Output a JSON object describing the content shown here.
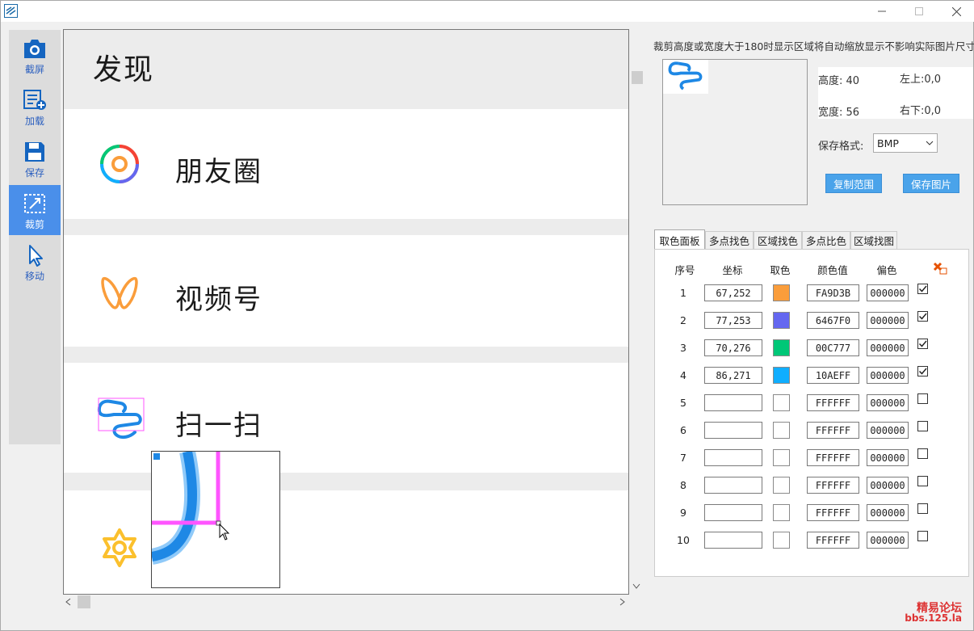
{
  "window": {
    "minimize_icon": "minimize-icon",
    "maximize_icon": "maximize-icon",
    "close_icon": "close-icon"
  },
  "sidebar": {
    "items": [
      {
        "label": "截屏",
        "icon": "camera-icon"
      },
      {
        "label": "加载",
        "icon": "load-list-icon"
      },
      {
        "label": "保存",
        "icon": "floppy-icon"
      },
      {
        "label": "裁剪",
        "icon": "crop-icon",
        "active": true
      },
      {
        "label": "移动",
        "icon": "cursor-icon"
      }
    ]
  },
  "canvas": {
    "header": "发现",
    "rows": [
      {
        "label": "朋友圈",
        "icon": "aperture-icon"
      },
      {
        "label": "视频号",
        "icon": "butterfly-icon"
      },
      {
        "label": "扫一扫",
        "icon": "scan-icon"
      },
      {
        "label": "",
        "icon": "star-icon"
      }
    ]
  },
  "right": {
    "tip": "裁剪高度或宽度大于180时显示区域将自动缩放显示不影响实际图片尺寸!",
    "height_label": "高度:",
    "height_value": "40",
    "width_label": "宽度:",
    "width_value": "56",
    "topleft_label": "左上:",
    "topleft_value": "0,0",
    "bottomright_label": "右下:",
    "bottomright_value": "0,0",
    "format_label": "保存格式:",
    "format_value": "BMP",
    "copy_button": "复制范围",
    "save_button": "保存图片"
  },
  "tabs": [
    "取色面板",
    "多点找色",
    "区域找色",
    "多点比色",
    "区域找图"
  ],
  "table": {
    "headers": [
      "序号",
      "坐标",
      "取色",
      "颜色值",
      "偏色"
    ],
    "rows": [
      {
        "no": "1",
        "coord": "67,252",
        "color": "#FA9D3B",
        "hex": "FA9D3B",
        "tol": "000000",
        "checked": true
      },
      {
        "no": "2",
        "coord": "77,253",
        "color": "#6467F0",
        "hex": "6467F0",
        "tol": "000000",
        "checked": true
      },
      {
        "no": "3",
        "coord": "70,276",
        "color": "#00C777",
        "hex": "00C777",
        "tol": "000000",
        "checked": true
      },
      {
        "no": "4",
        "coord": "86,271",
        "color": "#10AEFF",
        "hex": "10AEFF",
        "tol": "000000",
        "checked": true
      },
      {
        "no": "5",
        "coord": "",
        "color": "#FFFFFF",
        "hex": "FFFFFF",
        "tol": "000000",
        "checked": false
      },
      {
        "no": "6",
        "coord": "",
        "color": "#FFFFFF",
        "hex": "FFFFFF",
        "tol": "000000",
        "checked": false
      },
      {
        "no": "7",
        "coord": "",
        "color": "#FFFFFF",
        "hex": "FFFFFF",
        "tol": "000000",
        "checked": false
      },
      {
        "no": "8",
        "coord": "",
        "color": "#FFFFFF",
        "hex": "FFFFFF",
        "tol": "000000",
        "checked": false
      },
      {
        "no": "9",
        "coord": "",
        "color": "#FFFFFF",
        "hex": "FFFFFF",
        "tol": "000000",
        "checked": false
      },
      {
        "no": "10",
        "coord": "",
        "color": "#FFFFFF",
        "hex": "FFFFFF",
        "tol": "000000",
        "checked": false
      }
    ]
  },
  "watermark": {
    "line1": "精易论坛",
    "line2": "bbs.125.la"
  },
  "colors": {
    "accent": "#4a8fea",
    "button": "#4aa3ea",
    "selection": "#ff55ff",
    "scan_blue": "#1e88e5"
  }
}
